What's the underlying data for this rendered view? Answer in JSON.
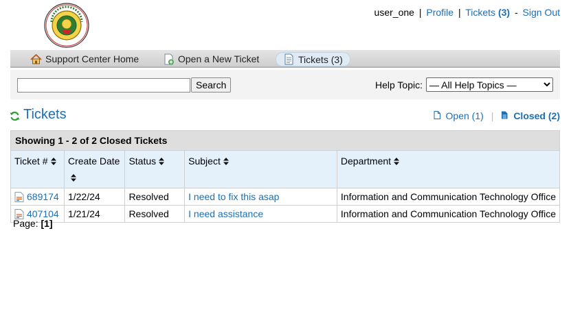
{
  "header": {
    "logo_text": "MINDANAO STATE UNIVERSITY · GEN. SANTOS CITY",
    "username": "user_one",
    "profile_label": "Profile",
    "tickets_label": "Tickets",
    "tickets_count": "(3)",
    "signout_label": "Sign Out",
    "sep_pipe": "|",
    "sep_dash": "-"
  },
  "nav": {
    "home": "Support Center Home",
    "new_ticket": "Open a New Ticket",
    "tickets": "Tickets (3)"
  },
  "search": {
    "input_value": "",
    "button_label": "Search",
    "help_topic_label": "Help Topic:",
    "help_topic_selected": "— All Help Topics —"
  },
  "page": {
    "title": "Tickets",
    "open_label": "Open (1)",
    "closed_label": "Closed (2)"
  },
  "table": {
    "caption": "Showing 1 - 2 of 2 Closed Tickets",
    "columns": [
      "Ticket #",
      "Create Date",
      "Status",
      "Subject",
      "Department"
    ],
    "rows": [
      {
        "number": "689174",
        "date": "1/22/24",
        "status": "Resolved",
        "subject": "I need to fix this asap",
        "department": "Information and Communication Technology Office"
      },
      {
        "number": "407104",
        "date": "1/21/24",
        "status": "Resolved",
        "subject": "I need assistance",
        "department": "Information and Communication Technology Office"
      }
    ]
  },
  "pager": {
    "label": "Page:",
    "current": "[1]"
  },
  "colors": {
    "link": "#1a6fb5",
    "header_row": "#e4f1fb",
    "caption_row": "#dedede"
  }
}
